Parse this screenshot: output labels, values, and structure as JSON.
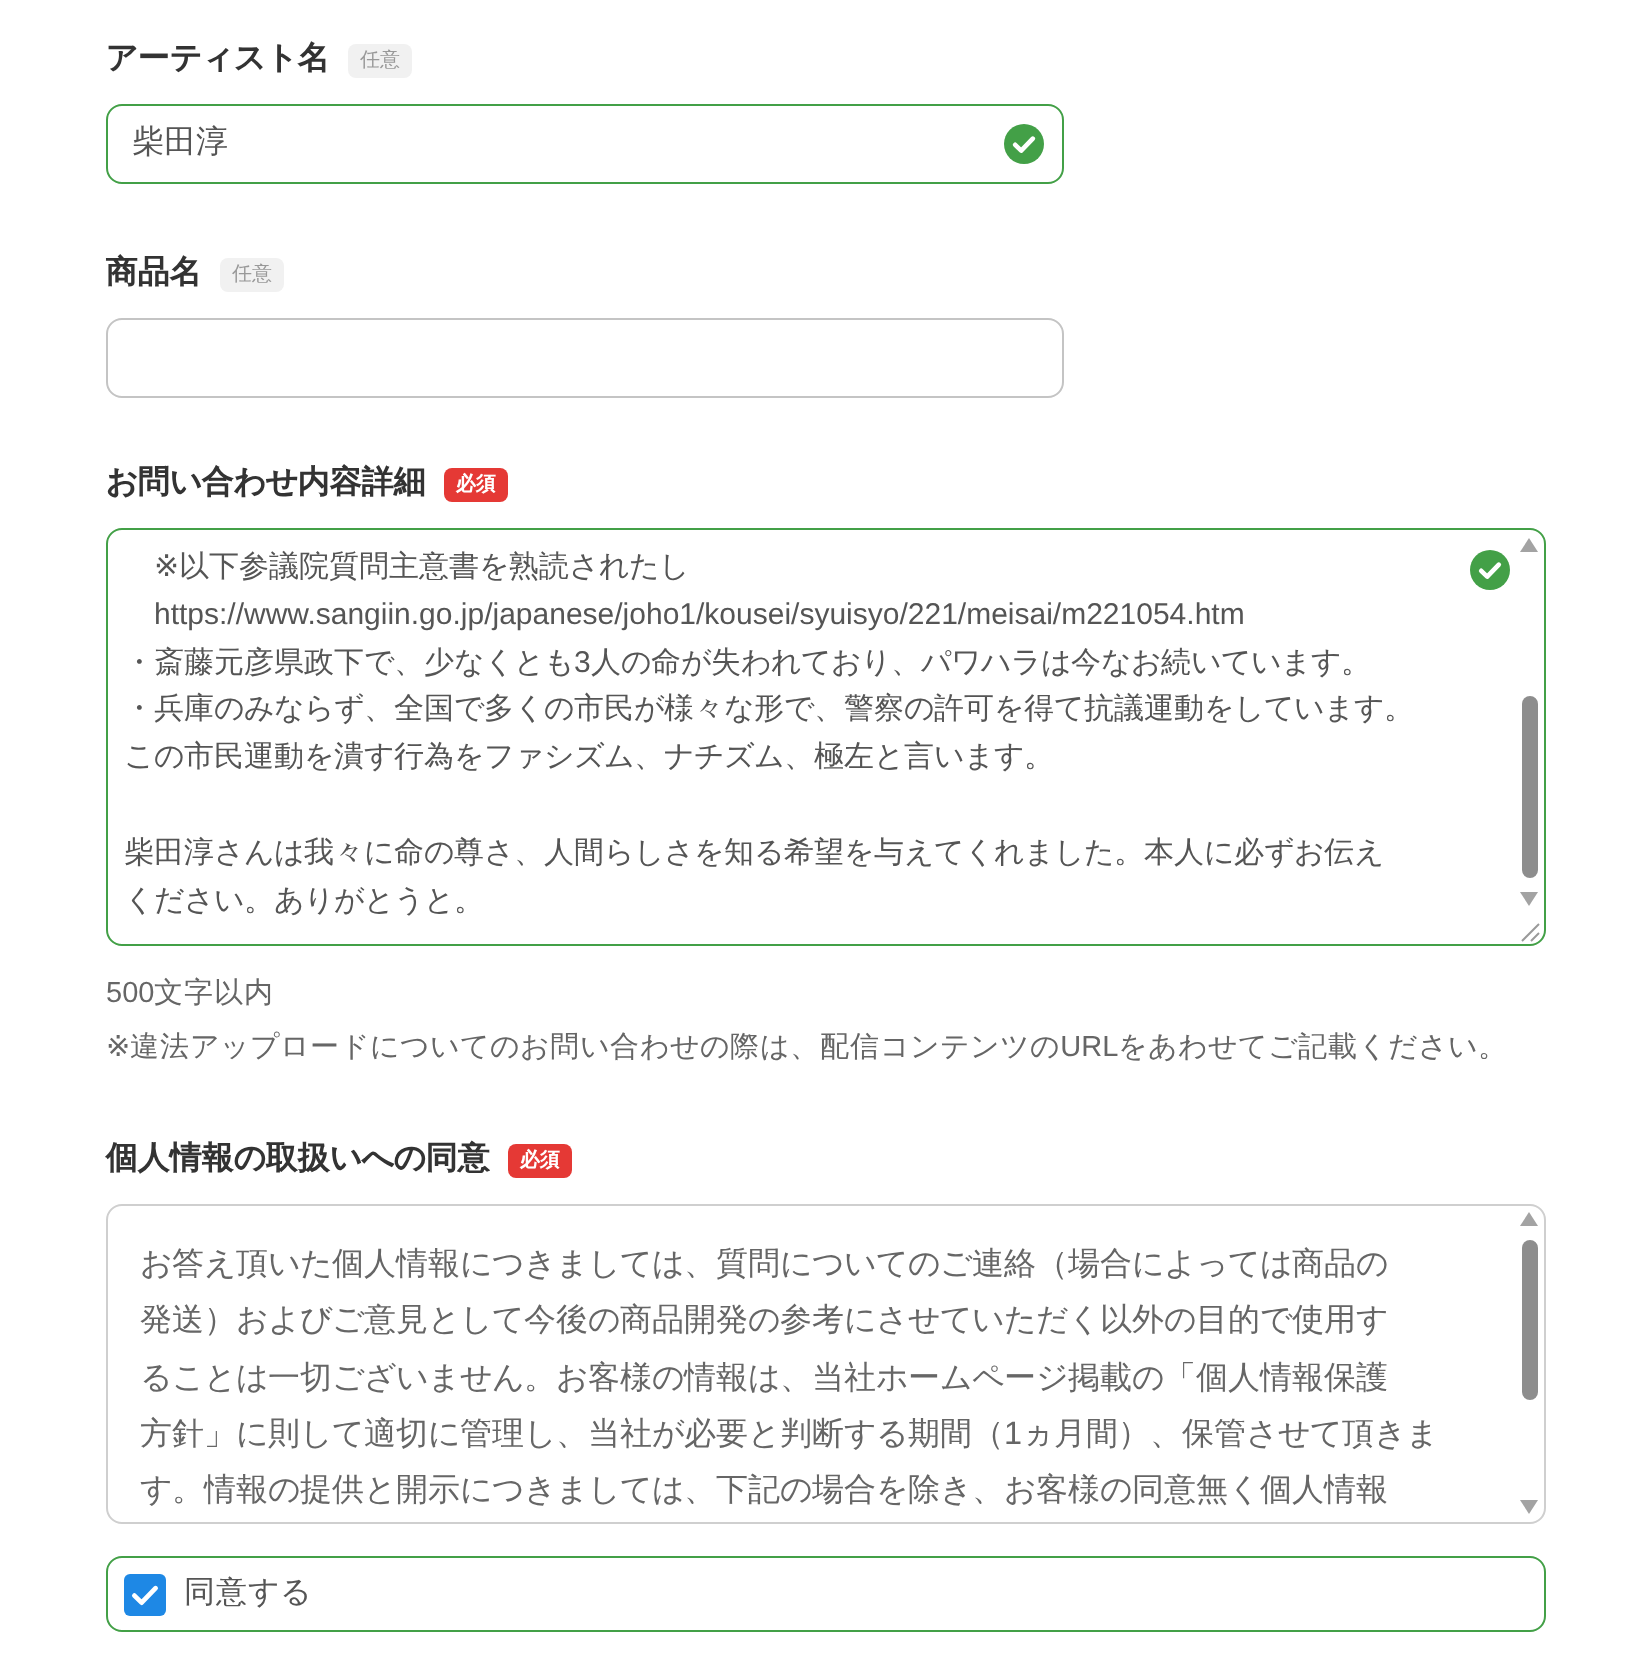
{
  "fields": [
    {
      "kind": "input",
      "label": "アーティスト名",
      "badge": {
        "kind": "optional",
        "text": "任意"
      },
      "value": "柴田淳",
      "valid": true
    },
    {
      "kind": "input",
      "label": "商品名",
      "badge": {
        "kind": "optional",
        "text": "任意"
      },
      "valid": false
    },
    {
      "kind": "textarea",
      "label": "お問い合わせ内容詳細",
      "badge": {
        "kind": "required",
        "text": "必須"
      },
      "paragraphs": [
        [
          "　※以下参議院質問主意書を熟読されたし",
          "　https://www.sangiin.go.jp/japanese/joho1/kousei/syuisyo/221/meisai/m221054.htm",
          "・斎藤元彦県政下で、少なくとも3人の命が失われており、パワハラは今なお続いています。",
          "・兵庫のみならず、全国で多くの市民が様々な形で、警察の許可を得て抗議運動をしています。",
          "この市民運動を潰す行為をファシズム、ナチズム、極左と言います。"
        ],
        [
          "柴田淳さんは我々に命の尊さ、人間らしさを知る希望を与えてくれました。本人に必ずお伝え",
          "ください。ありがとうと。"
        ]
      ],
      "valid": true,
      "notes": [
        "500文字以内",
        "※違法アップロードについてのお問い合わせの際は、配信コンテンツのURLをあわせてご記載ください。"
      ]
    },
    {
      "kind": "consent",
      "label": "個人情報の取扱いへの同意",
      "badge": {
        "kind": "required",
        "text": "必須"
      },
      "terms_lines": [
        "お答え頂いた個人情報につきましては、質問についてのご連絡（場合によっては商品の",
        "発送）およびご意見として今後の商品開発の参考にさせていただく以外の目的で使用す",
        "ることは一切ございません。お客様の情報は、当社ホームページ掲載の「個人情報保護",
        "方針」に則して適切に管理し、当社が必要と判断する期間（1ヵ月間）、保管させて頂きま",
        "す。情報の提供と開示につきましては、下記の場合を除き、お客様の同意無く個人情報"
      ],
      "checkbox": {
        "label": "同意する",
        "checked": true
      },
      "valid": true
    }
  ]
}
